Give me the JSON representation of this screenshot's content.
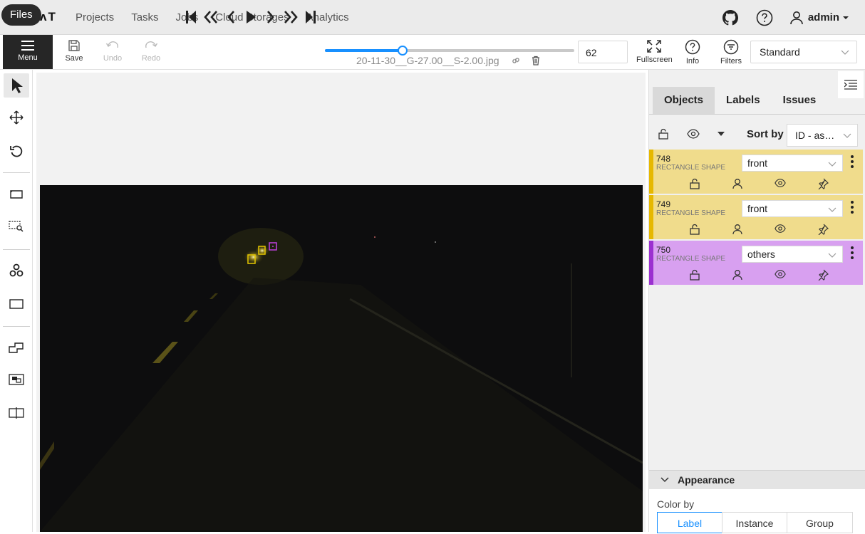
{
  "header": {
    "files_tooltip": "Files",
    "logo": "ʌT",
    "nav": [
      "Projects",
      "Tasks",
      "Jobs",
      "Cloud Storages",
      "Analytics"
    ],
    "user": "admin"
  },
  "toolbar": {
    "menu_label": "Menu",
    "save_label": "Save",
    "undo_label": "Undo",
    "redo_label": "Redo",
    "filename": "20-11-30__G-27.00__S-2.00.jpg",
    "frame_number": "62",
    "frame_progress": 0.31,
    "fullscreen_label": "Fullscreen",
    "info_label": "Info",
    "filters_label": "Filters",
    "workspace": "Standard"
  },
  "sidebar": {
    "tabs": [
      "Objects",
      "Labels",
      "Issues"
    ],
    "sort_by_label": "Sort by",
    "sort_value": "ID - as…",
    "objects": [
      {
        "id": "748",
        "type": "RECTANGLE SHAPE",
        "label": "front",
        "color": "#f0dc8c",
        "border": "#e6b800"
      },
      {
        "id": "749",
        "type": "RECTANGLE SHAPE",
        "label": "front",
        "color": "#f0dc8c",
        "border": "#e6b800"
      },
      {
        "id": "750",
        "type": "RECTANGLE SHAPE",
        "label": "others",
        "color": "#d8a0f0",
        "border": "#9b30d0"
      }
    ],
    "appearance_title": "Appearance",
    "color_by_label": "Color by",
    "color_by_options": [
      "Label",
      "Instance",
      "Group"
    ]
  },
  "colors": {
    "accent": "#1890ff",
    "menu_bg": "#262626"
  }
}
